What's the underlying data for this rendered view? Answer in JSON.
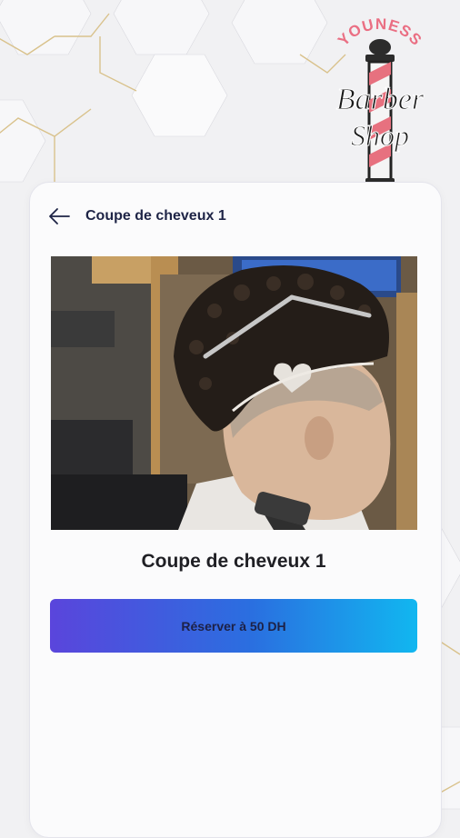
{
  "header": {
    "title": "Coupe de cheveux 1"
  },
  "logo": {
    "line_top": "YOUNESS",
    "line1": "Barber",
    "line2": "Shop",
    "line_bottom": "YOUNESS"
  },
  "service": {
    "name": "Coupe de cheveux 1"
  },
  "actions": {
    "reserve_label": "Réserver à 50 DH"
  },
  "colors": {
    "accent_start": "#5a45dc",
    "accent_end": "#11b7f0",
    "gold_lines": "#d8c08a",
    "title": "#1e2446"
  },
  "icons": {
    "back": "arrow-left-icon"
  }
}
